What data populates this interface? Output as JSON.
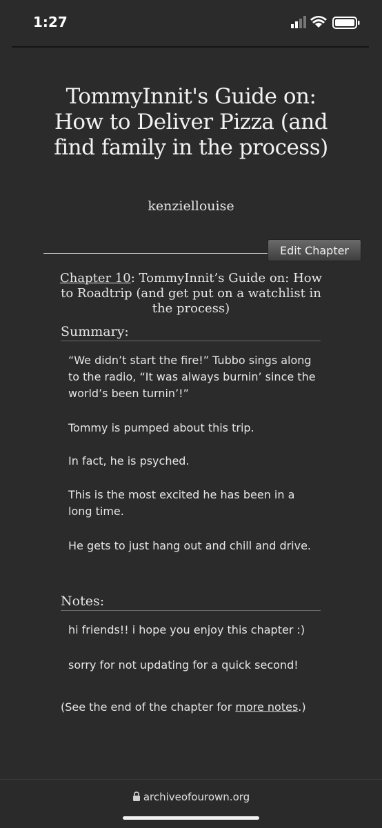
{
  "status_bar": {
    "time": "1:27"
  },
  "work": {
    "title": "TommyInnit's Guide on: How to Deliver Pizza (and find family in the process)",
    "author": "kenziellouise"
  },
  "edit_chapter_label": "Edit Chapter",
  "chapter": {
    "number_label": "Chapter 10",
    "title_rest": ": TommyInnit’s Guide on: How to Roadtrip (and get put on a watchlist in the process)"
  },
  "summary": {
    "heading": "Summary:",
    "paragraphs": [
      "“We didn’t start the fire!” Tubbo sings along to the radio, “It was always burnin’ since the world’s been turnin’!”",
      "Tommy is pumped about this trip.",
      "In fact, he is psyched.",
      "This is the most excited he has been in a long time.",
      "He gets to just hang out and chill and drive."
    ]
  },
  "notes": {
    "heading": "Notes:",
    "line1": "hi friends!! i hope you enjoy this chapter :)",
    "line2": "sorry for not updating for a quick second!",
    "end_prefix": "(See the end of the chapter for ",
    "end_link": "more notes",
    "end_suffix": ".)"
  },
  "browser": {
    "url": "archiveofourown.org"
  }
}
